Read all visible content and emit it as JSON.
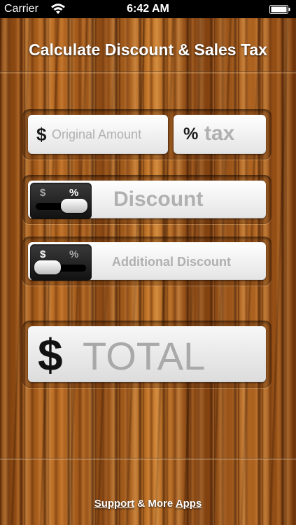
{
  "status_bar": {
    "carrier": "Carrier",
    "time": "6:42 AM",
    "icons": [
      "wifi-icon",
      "battery-icon"
    ]
  },
  "title": "Calculate Discount & Sales Tax",
  "original_amount": {
    "symbol": "$",
    "placeholder": "Original Amount"
  },
  "tax": {
    "symbol": "%",
    "placeholder": "tax"
  },
  "discount": {
    "toggle": {
      "dollar": "$",
      "percent": "%",
      "selected": "percent"
    },
    "placeholder": "Discount"
  },
  "additional_discount": {
    "toggle": {
      "dollar": "$",
      "percent": "%",
      "selected": "dollar"
    },
    "placeholder": "Additional Discount"
  },
  "total": {
    "symbol": "$",
    "placeholder": "TOTAL"
  },
  "footer": {
    "support_link": "Support",
    "middle_text": " & More ",
    "apps_link": "Apps"
  },
  "colors": {
    "wood": "#8a4a12",
    "placeholder": "#b0b0b0",
    "title": "#ffffff"
  }
}
